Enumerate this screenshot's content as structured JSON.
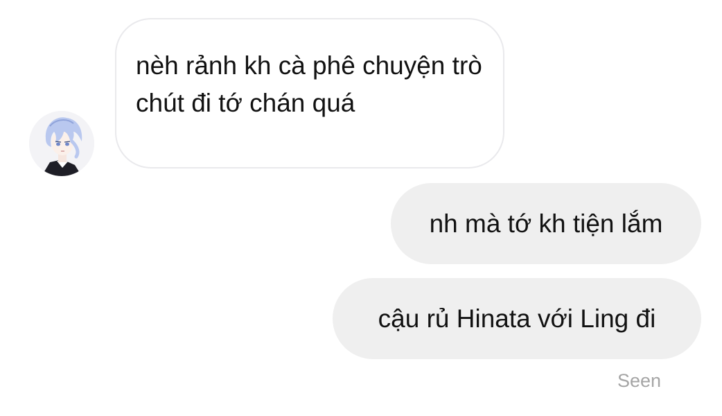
{
  "incoming_message": {
    "text": "nèh rảnh kh cà phê chuyện trò chút đi tớ chán quá"
  },
  "outgoing_messages": [
    {
      "text": "nh mà tớ kh tiện lắm"
    },
    {
      "text": "cậu rủ Hinata với Ling đi"
    }
  ],
  "status": {
    "seen_label": "Seen"
  },
  "colors": {
    "incoming_border": "#e9e9ec",
    "outgoing_bg": "#efefef",
    "seen_text": "#a5a5a5",
    "avatar_hair": "#b9c8ef"
  },
  "icons": {
    "avatar": "anime-avatar-icon"
  }
}
